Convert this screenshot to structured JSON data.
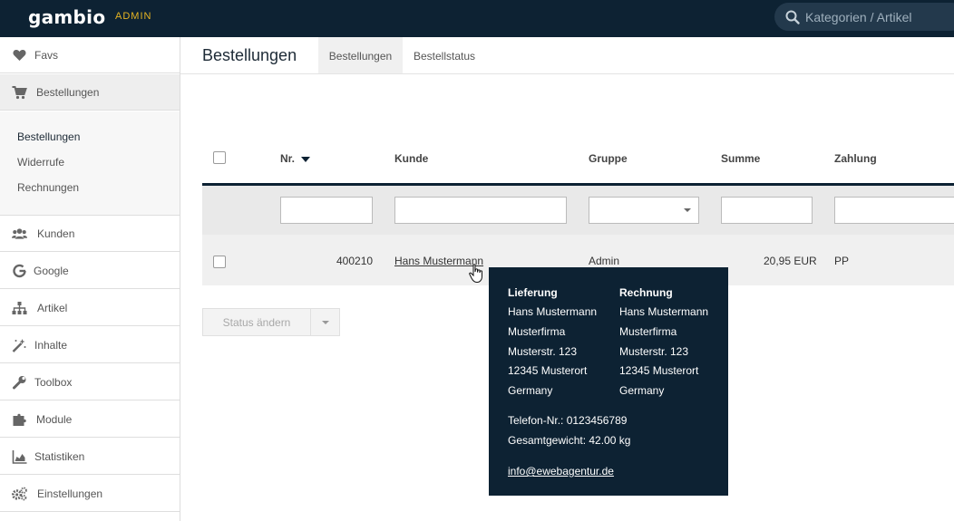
{
  "topbar": {
    "logo": "gambio",
    "admin_label": "ADMIN",
    "search_placeholder": "Kategorien / Artikel"
  },
  "sidebar": {
    "items": [
      {
        "label": "Favs",
        "icon": "heart-icon"
      },
      {
        "label": "Bestellungen",
        "icon": "cart-icon"
      },
      {
        "label": "Kunden",
        "icon": "users-icon"
      },
      {
        "label": "Google",
        "icon": "google-icon"
      },
      {
        "label": "Artikel",
        "icon": "sitemap-icon"
      },
      {
        "label": "Inhalte",
        "icon": "magic-wand-icon"
      },
      {
        "label": "Toolbox",
        "icon": "wrench-icon"
      },
      {
        "label": "Module",
        "icon": "puzzle-icon"
      },
      {
        "label": "Statistiken",
        "icon": "area-chart-icon"
      },
      {
        "label": "Einstellungen",
        "icon": "gears-icon"
      }
    ],
    "submenu": [
      "Bestellungen",
      "Widerrufe",
      "Rechnungen"
    ]
  },
  "header": {
    "title": "Bestellungen",
    "tabs": [
      "Bestellungen",
      "Bestellstatus"
    ]
  },
  "table": {
    "columns": [
      "Nr.",
      "Kunde",
      "Gruppe",
      "Summe",
      "Zahlung"
    ],
    "rows": [
      {
        "nr": "400210",
        "kunde": "Hans Mustermann",
        "gruppe": "Admin",
        "summe": "20,95 EUR",
        "zahlung": "PP"
      }
    ]
  },
  "actions": {
    "status_button": "Status ändern"
  },
  "tooltip": {
    "lieferung_title": "Lieferung",
    "rechnung_title": "Rechnung",
    "lieferung": [
      "Hans Mustermann",
      "Musterfirma",
      "Musterstr. 123",
      "12345 Musterort",
      "Germany"
    ],
    "rechnung": [
      "Hans Mustermann",
      "Musterfirma",
      "Musterstr. 123",
      "12345 Musterort",
      "Germany"
    ],
    "phone": "Telefon-Nr.: 0123456789",
    "weight": "Gesamtgewicht: 42.00 kg",
    "email": "info@ewebagentur.de"
  },
  "colors": {
    "topbar_bg": "#0d2233",
    "admin_accent": "#e6b422",
    "tooltip_bg": "#0d2233"
  }
}
